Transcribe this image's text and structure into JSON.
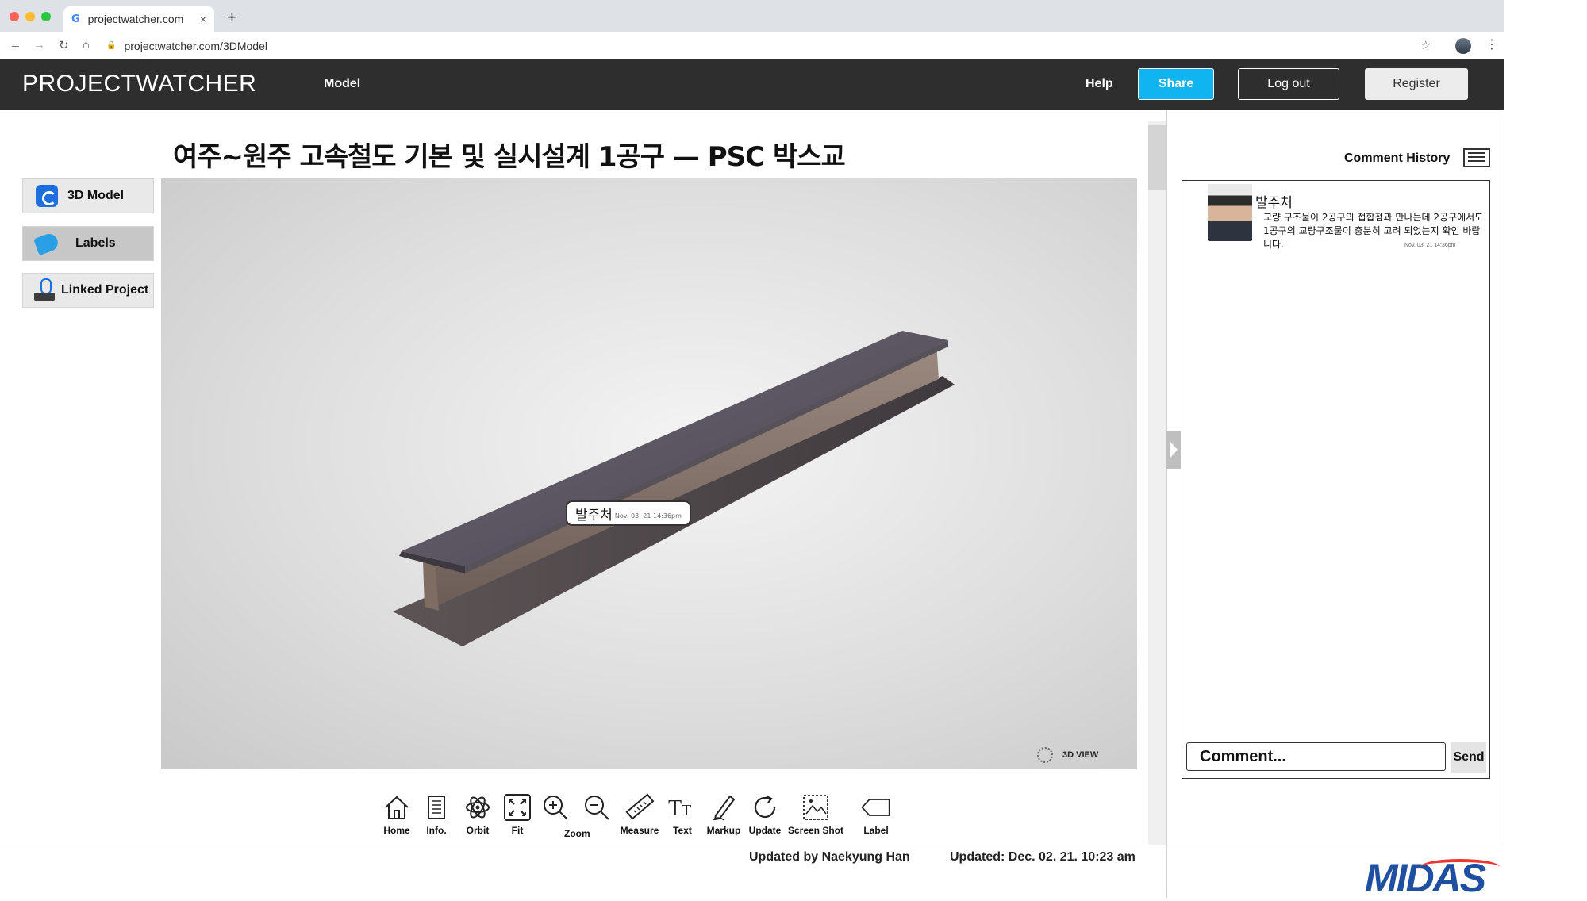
{
  "browser": {
    "tab_title": "projectwatcher.com",
    "tab_close": "×",
    "new_tab": "+",
    "url": "projectwatcher.com/3DModel"
  },
  "header": {
    "logo": "PROJECTWATCHER",
    "nav_model": "Model",
    "help": "Help",
    "share": "Share",
    "logout": "Log out",
    "register": "Register"
  },
  "sidebar": {
    "items": [
      {
        "label": "3D Model",
        "icon": "3d-model-icon",
        "active": false
      },
      {
        "label": "Labels",
        "icon": "tag-icon",
        "active": true
      },
      {
        "label": "Linked Project",
        "icon": "link-icon",
        "active": false
      }
    ]
  },
  "main": {
    "title": "여주~원주 고속철도 기본 및 실시설계 1공구 — PSC 박스교",
    "label_pin": {
      "author": "발주처",
      "timestamp": "Nov. 03. 21 14:36pm"
    },
    "view_label": "3D VIEW"
  },
  "toolbar": {
    "items": [
      {
        "label": "Home",
        "icon": "home-icon"
      },
      {
        "label": "Info.",
        "icon": "info-icon"
      },
      {
        "label": "Orbit",
        "icon": "orbit-icon"
      },
      {
        "label": "Fit",
        "icon": "fit-icon"
      },
      {
        "label": "Zoom",
        "icon": "zoom-in-icon"
      },
      {
        "label": "",
        "icon": "zoom-out-icon"
      },
      {
        "label": "Measure",
        "icon": "measure-icon"
      },
      {
        "label": "Text",
        "icon": "text-icon"
      },
      {
        "label": "Markup",
        "icon": "markup-icon"
      },
      {
        "label": "Update",
        "icon": "update-icon"
      },
      {
        "label": "Screen Shot",
        "icon": "screenshot-icon"
      },
      {
        "label": "Label",
        "icon": "label-icon"
      }
    ]
  },
  "footer": {
    "updated_by": "Updated by Naekyung Han",
    "updated_at": "Updated: Dec. 02. 21. 10:23 am",
    "brand": "MIDAS"
  },
  "comments": {
    "title": "Comment History",
    "items": [
      {
        "author": "발주처",
        "text": "교량 구조물이 2공구의 접합점과 만나는데 2공구에서도 1공구의 교량구조물이 충분히 고려 되었는지 확인 바랍니다.",
        "timestamp": "Nov. 03. 21 14:36pm"
      }
    ],
    "input_placeholder": "Comment...",
    "send": "Send"
  }
}
